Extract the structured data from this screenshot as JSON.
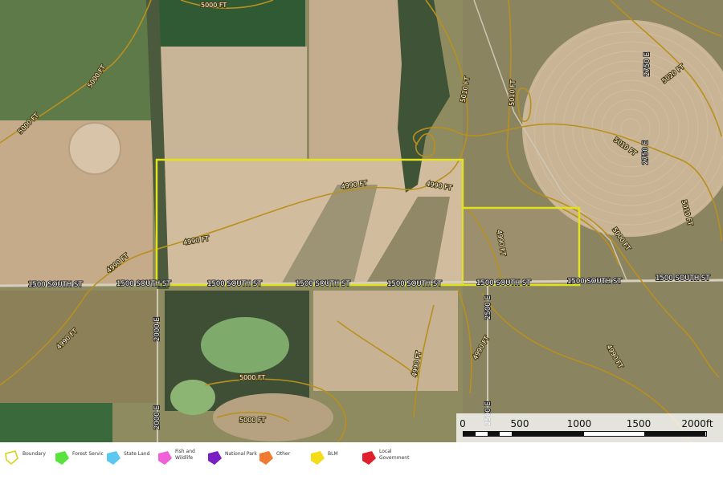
{
  "map": {
    "contour_labels": [
      "5000 FT",
      "5000 FT",
      "5000 FT",
      "5010 FT",
      "5020 FT",
      "5010 FT",
      "5010 FT",
      "5010 FT",
      "5000 FT",
      "4990 FT",
      "4990 FT",
      "4990 FT",
      "4990 FT",
      "4990 FT",
      "4990 FT",
      "4990 FT",
      "4990 FT",
      "4990 FT",
      "5000 FT",
      "5000 FT"
    ],
    "road_labels": [
      "1500 SOUTH ST",
      "1500 SOUTH ST",
      "1500 SOUTH ST",
      "1500 SOUTH ST",
      "1500 SOUTH ST",
      "1500 SOUTH ST",
      "1500 SOUTH ST",
      "1500 SOUTH ST",
      "2000 E",
      "2000 E",
      "2500 E",
      "2500 E",
      "2750 E",
      "2750 E"
    ],
    "boundary_color": "#e2e21c"
  },
  "scale_bar": {
    "labels": [
      "0",
      "500",
      "1000",
      "1500",
      "2000ft"
    ]
  },
  "legend": [
    {
      "label": "Boundary",
      "color": "#e2e21c",
      "icon": "boundary-outline-icon"
    },
    {
      "label": "Forest Servic",
      "color": "#59e33c",
      "icon": "forest-service-icon"
    },
    {
      "label": "State Land",
      "color": "#5ac8f0",
      "icon": "state-land-icon"
    },
    {
      "label": "Fish and Wildlife",
      "color": "#f060d8",
      "icon": "fish-wildlife-icon"
    },
    {
      "label": "National Park",
      "color": "#7a1fc4",
      "icon": "national-park-icon"
    },
    {
      "label": "Other",
      "color": "#f07a30",
      "icon": "other-icon"
    },
    {
      "label": "BLM",
      "color": "#f5dc1a",
      "icon": "blm-icon"
    },
    {
      "label": "Local Government",
      "color": "#e01f2a",
      "icon": "local-government-icon"
    }
  ]
}
